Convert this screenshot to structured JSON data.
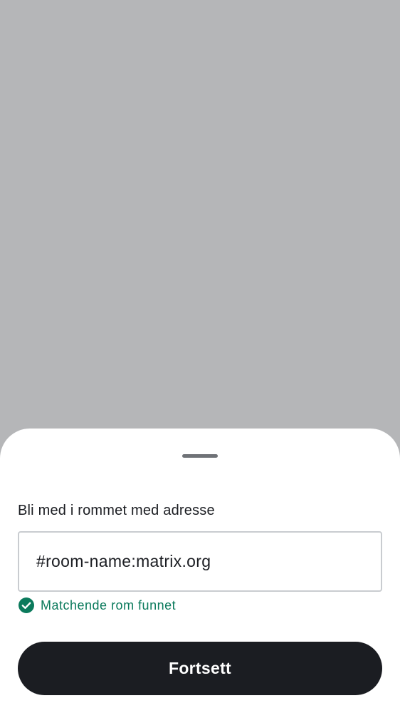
{
  "sheet": {
    "label": "Bli med i rommet med adresse",
    "address_value": "#room-name:matrix.org",
    "status_text": "Matchende rom funnet",
    "status_icon": "check-circle-icon",
    "continue_label": "Fortsett"
  },
  "colors": {
    "scrim": "#b5b6b8",
    "sheet_background": "#ffffff",
    "primary_button": "#1b1d22",
    "success": "#0b7a5c",
    "input_border": "#c9ccd0"
  }
}
